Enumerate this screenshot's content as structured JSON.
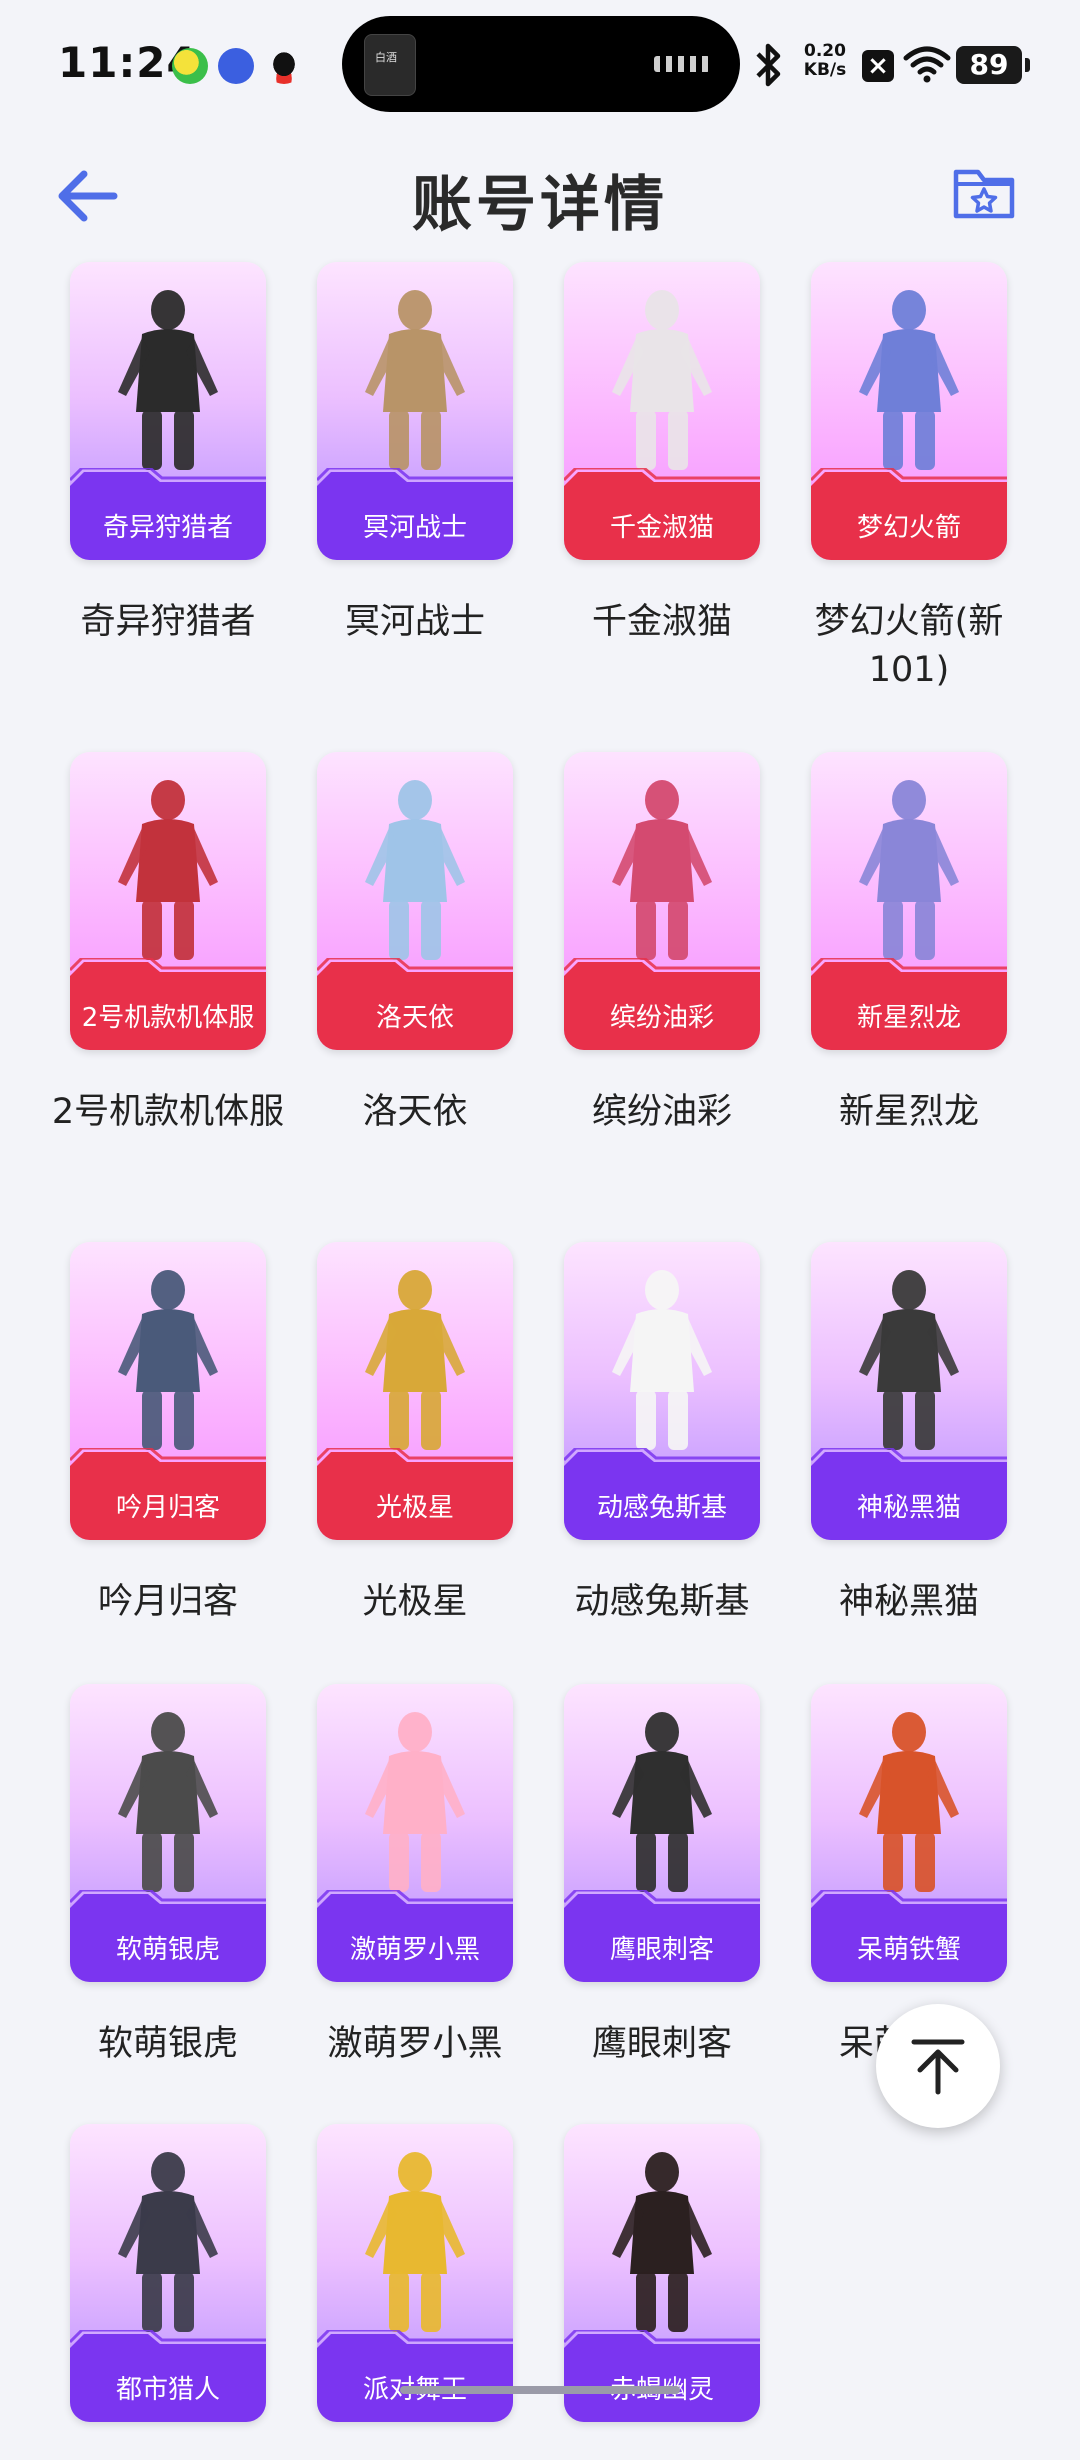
{
  "status_bar": {
    "time": "11:24",
    "net_speed_value": "0.20",
    "net_speed_unit": "KB/s",
    "battery": "89",
    "island_thumb_text": "白酒",
    "icons": [
      "green-app-icon",
      "blue-app-icon",
      "qq-icon",
      "bluetooth-icon",
      "close-icon",
      "wifi-icon",
      "battery-icon"
    ]
  },
  "header": {
    "title": "账号详情",
    "back_icon": "back-arrow-icon",
    "fav_icon": "folder-star-icon"
  },
  "colors": {
    "accent": "#4f6ee8",
    "ribbon_purple": "#7b35f0",
    "ribbon_red": "#e8304a",
    "background": "#f3f4f9"
  },
  "items": [
    {
      "card_label": "奇异狩猎者",
      "name": "奇异狩猎者",
      "theme": "purple"
    },
    {
      "card_label": "冥河战士",
      "name": "冥河战士",
      "theme": "purple"
    },
    {
      "card_label": "千金淑猫",
      "name": "千金淑猫",
      "theme": "red"
    },
    {
      "card_label": "梦幻火箭",
      "name": "梦幻火箭(新101)",
      "theme": "red"
    },
    {
      "card_label": "2号机款机体服",
      "name": "2号机款机体服",
      "theme": "red"
    },
    {
      "card_label": "洛天依",
      "name": "洛天依",
      "theme": "red"
    },
    {
      "card_label": "缤纷油彩",
      "name": "缤纷油彩",
      "theme": "red"
    },
    {
      "card_label": "新星烈龙",
      "name": "新星烈龙",
      "theme": "red"
    },
    {
      "card_label": "吟月归客",
      "name": "吟月归客",
      "theme": "red"
    },
    {
      "card_label": "光极星",
      "name": "光极星",
      "theme": "red"
    },
    {
      "card_label": "动感兔斯基",
      "name": "动感兔斯基",
      "theme": "purple"
    },
    {
      "card_label": "神秘黑猫",
      "name": "神秘黑猫",
      "theme": "purple"
    },
    {
      "card_label": "软萌银虎",
      "name": "软萌银虎",
      "theme": "purple"
    },
    {
      "card_label": "激萌罗小黑",
      "name": "激萌罗小黑",
      "theme": "purple"
    },
    {
      "card_label": "鹰眼刺客",
      "name": "鹰眼刺客",
      "theme": "purple"
    },
    {
      "card_label": "呆萌铁蟹",
      "name": "呆萌铁蟹",
      "theme": "purple"
    },
    {
      "card_label": "都市猎人",
      "name": "",
      "theme": "purple"
    },
    {
      "card_label": "派对舞王",
      "name": "",
      "theme": "purple"
    },
    {
      "card_label": "赤蝎幽灵",
      "name": "",
      "theme": "purple"
    }
  ],
  "scroll_top": {
    "icon": "scroll-to-top-icon"
  }
}
